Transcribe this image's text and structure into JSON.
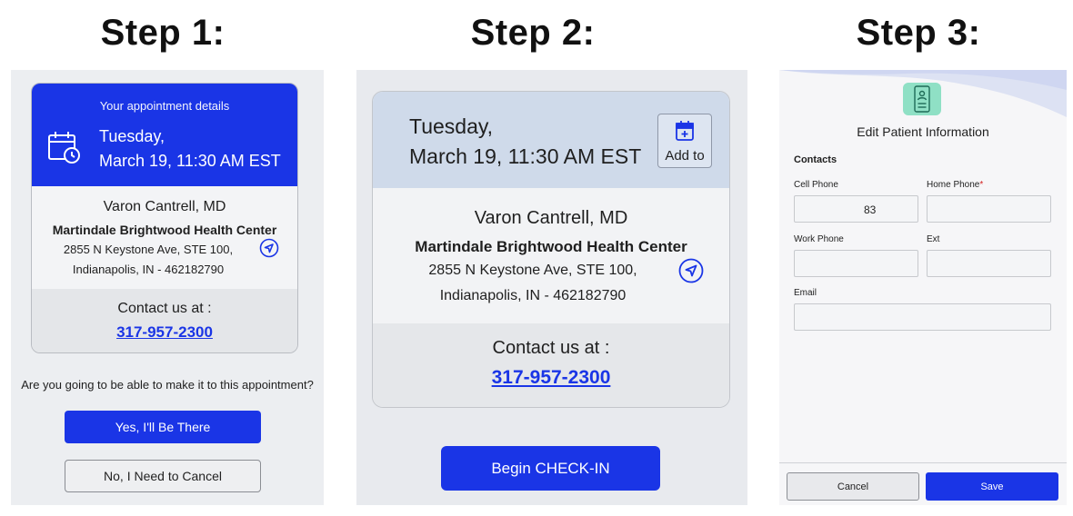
{
  "steps": [
    "Step 1:",
    "Step 2:",
    "Step 3:"
  ],
  "step1": {
    "caption": "Your appointment details",
    "day": "Tuesday,",
    "datetime": "March 19, 11:30 AM EST",
    "doctor": "Varon Cantrell, MD",
    "center": "Martindale Brightwood Health Center",
    "address1": "2855 N Keystone Ave, STE 100,",
    "address2": "Indianapolis, IN - 462182790",
    "contact_label": "Contact us at :",
    "phone": "317-957-2300",
    "question": "Are you going to be able to make it to this appointment?",
    "yes_label": "Yes, I'll Be There",
    "no_label": "No, I Need to Cancel"
  },
  "step2": {
    "day": "Tuesday,",
    "datetime": "March 19, 11:30 AM EST",
    "add_label": "Add to",
    "doctor": "Varon Cantrell, MD",
    "center": "Martindale Brightwood Health Center",
    "address1": "2855 N Keystone Ave, STE 100,",
    "address2": "Indianapolis, IN - 462182790",
    "contact_label": "Contact us at :",
    "phone": "317-957-2300",
    "checkin_label": "Begin CHECK-IN"
  },
  "step3": {
    "title": "Edit Patient Information",
    "section": "Contacts",
    "cell_label": "Cell Phone",
    "cell_value": "83",
    "home_label": "Home Phone",
    "home_required": "*",
    "work_label": "Work Phone",
    "ext_label": "Ext",
    "email_label": "Email",
    "cancel_label": "Cancel",
    "save_label": "Save"
  },
  "colors": {
    "primary": "#1a35e6",
    "header_light": "#cfdaea",
    "panel_bg": "#eceef1",
    "badge": "#8fe0c5",
    "required": "#d21f1f"
  },
  "icons": [
    "calendar-clock-icon",
    "navigation-arrow-icon",
    "calendar-add-icon",
    "patient-card-icon"
  ]
}
